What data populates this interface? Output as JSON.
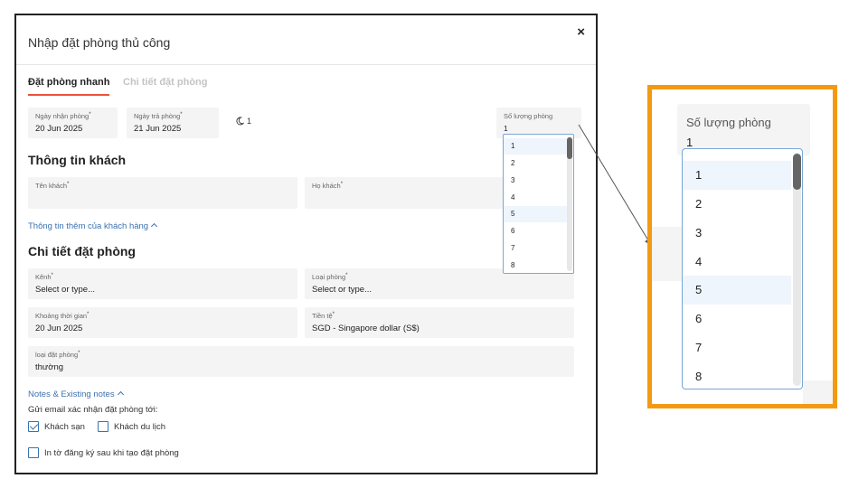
{
  "modal": {
    "title": "Nhập đặt phòng thủ công",
    "close_icon": "×",
    "tabs": [
      {
        "label": "Đặt phòng nhanh",
        "active": true
      },
      {
        "label": "Chi tiết đặt phòng",
        "active": false
      }
    ],
    "checkin": {
      "label": "Ngày nhận phòng",
      "value": "20 Jun 2025"
    },
    "checkout": {
      "label": "Ngày trả phòng",
      "value": "21 Jun 2025"
    },
    "nights": {
      "icon": "moon-icon",
      "value": "1"
    },
    "rooms": {
      "label": "Số lượng phòng",
      "value": "1",
      "options": [
        "1",
        "2",
        "3",
        "4",
        "5",
        "6",
        "7",
        "8"
      ],
      "selected": "1",
      "hovered": "5"
    },
    "guest_section": {
      "title": "Thông tin khách",
      "first_name_label": "Tên khách",
      "last_name_label": "Họ khách",
      "more_info_link": "Thông tin thêm của khách hàng"
    },
    "booking_section": {
      "title": "Chi tiết đặt phòng",
      "channel": {
        "label": "Kênh",
        "value": "Select or type..."
      },
      "room_type": {
        "label": "Loại phòng",
        "value": "Select or type..."
      },
      "period": {
        "label": "Khoảng thời gian",
        "value": "20 Jun 2025"
      },
      "currency": {
        "label": "Tiền tệ",
        "value": "SGD - Singapore dollar (S$)"
      },
      "booking_type": {
        "label": "loại đặt phòng",
        "value": "thường"
      }
    },
    "notes_link": "Notes & Existing notes",
    "email_prompt": "Gửi email xác nhận đặt phòng tới:",
    "checkboxes": {
      "hotel": {
        "label": "Khách sạn",
        "checked": true
      },
      "travel_agent": {
        "label": "Khách du lịch",
        "checked": false
      },
      "print_form": {
        "label": "In tờ đăng ký sau khi tạo đặt phòng",
        "checked": false
      }
    }
  },
  "zoom_callout": {
    "label": "Số lượng phòng",
    "value": "1",
    "options": [
      "1",
      "2",
      "3",
      "4",
      "5",
      "6",
      "7",
      "8"
    ],
    "border_color": "#f39a12"
  },
  "colors": {
    "accent": "#e9533a",
    "link": "#3a72b0",
    "highlight": "#eef5fc",
    "callout": "#f39a12"
  }
}
